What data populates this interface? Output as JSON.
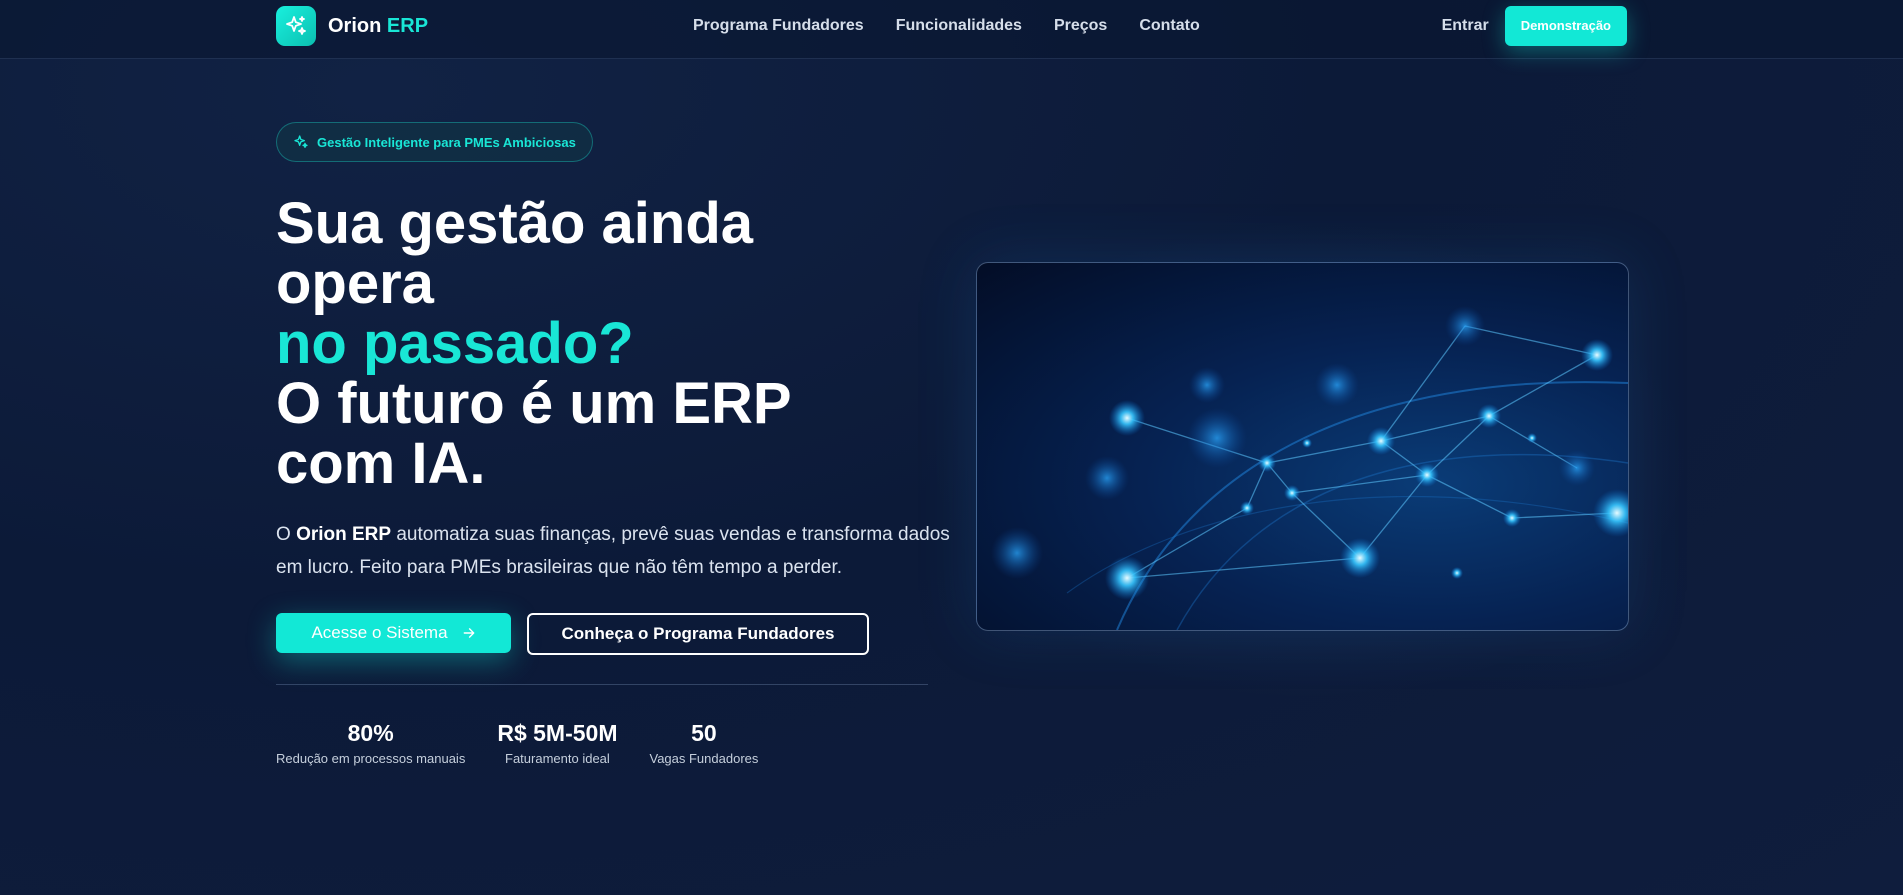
{
  "brand": {
    "name": "Orion",
    "accent": "ERP",
    "icon": "sparkle-icon"
  },
  "nav": {
    "links": [
      "Programa Fundadores",
      "Funcionalidades",
      "Preços",
      "Contato"
    ],
    "login": "Entrar",
    "demo": "Demonstração"
  },
  "hero": {
    "badge": "Gestão Inteligente para PMEs Ambiciosas",
    "headline_1": "Sua gestão ainda",
    "headline_2": "opera",
    "headline_accent": "no passado?",
    "headline_3": "O futuro é um ERP",
    "headline_4": "com IA.",
    "lead_prefix": "O",
    "lead_brand": "Orion ERP",
    "lead_text": "automatiza suas finanças, prevê suas vendas e transforma dados em lucro. Feito para PMEs brasileiras que não têm tempo a perder.",
    "cta_primary": "Acesse o Sistema",
    "cta_secondary": "Conheça o Programa Fundadores"
  },
  "stats": [
    {
      "value": "80%",
      "label": "Redução em processos manuais"
    },
    {
      "value": "R$ 5M-50M",
      "label": "Faturamento ideal"
    },
    {
      "value": "50",
      "label": "Vagas Fundadores"
    }
  ],
  "colors": {
    "accent": "#12e8d6",
    "background": "#0c1a38"
  }
}
